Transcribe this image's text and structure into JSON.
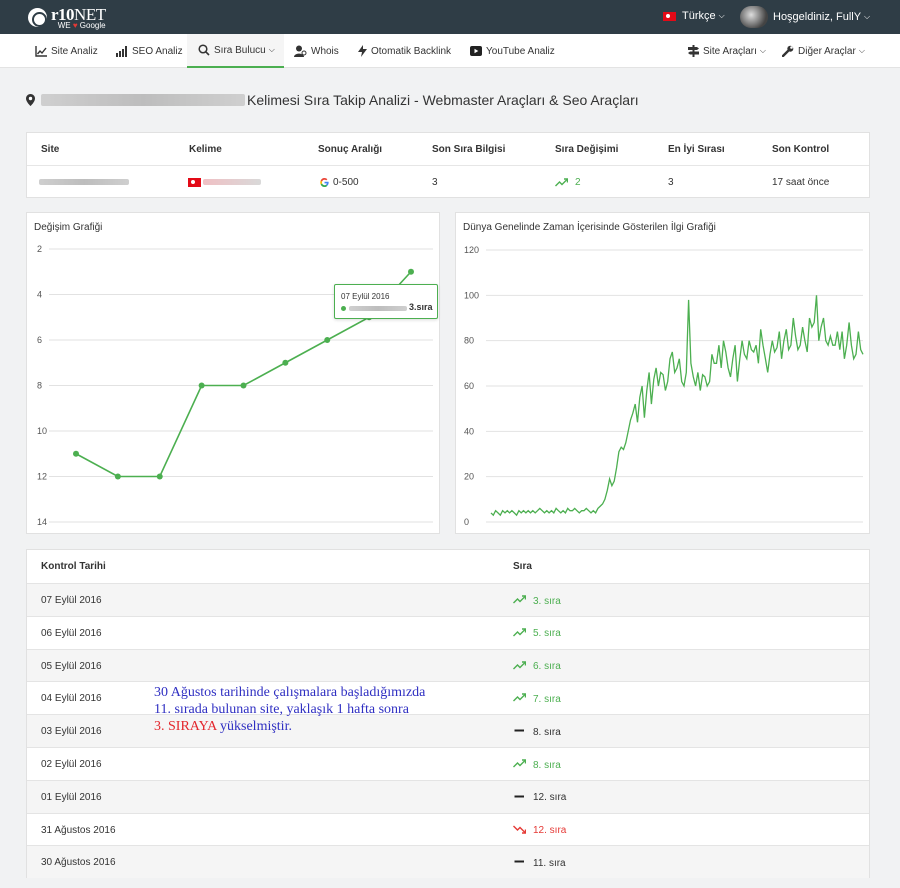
{
  "topbar": {
    "logo_main": "r10",
    "logo_net": "NET",
    "logo_sub_we": "WE",
    "logo_sub_google": "Google",
    "language": "Türkçe",
    "user_greeting": "Hoşgeldiniz, FullY"
  },
  "nav": {
    "items": [
      {
        "label": "Site Analiz",
        "icon": "chart-line-icon"
      },
      {
        "label": "SEO Analiz",
        "icon": "bar-chart-icon"
      },
      {
        "label": "Sıra Bulucu",
        "icon": "search-icon",
        "active": true
      },
      {
        "label": "Whois",
        "icon": "user-search-icon"
      },
      {
        "label": "Otomatik Backlink",
        "icon": "bolt-icon"
      },
      {
        "label": "YouTube Analiz",
        "icon": "youtube-icon"
      }
    ],
    "right_items": [
      {
        "label": "Site Araçları",
        "icon": "signpost-icon"
      },
      {
        "label": "Diğer Araçlar",
        "icon": "wrench-icon"
      }
    ]
  },
  "page": {
    "title": "Kelimesi Sıra Takip Analizi - Webmaster Araçları & Seo Araçları"
  },
  "info_table": {
    "headers": [
      "Site",
      "Kelime",
      "Sonuç Aralığı",
      "Son Sıra Bilgisi",
      "Sıra Değişimi",
      "En İyi Sırası",
      "Son Kontrol"
    ],
    "row": {
      "result_range": "0-500",
      "last_rank": "3",
      "rank_change": "2",
      "best_rank": "3",
      "last_check": "17 saat önce"
    }
  },
  "change_chart": {
    "title": "Değişim Grafiği",
    "tooltip_date": "07 Eylül 2016",
    "tooltip_value": "3.sıra"
  },
  "interest_chart": {
    "title": "Dünya Genelinde Zaman İçerisinde Gösterilen İlgi Grafiği"
  },
  "chart_data": [
    {
      "type": "line",
      "title": "Değişim Grafiği",
      "x": [
        "30 Ağustos 2016",
        "31 Ağustos 2016",
        "01 Eylül 2016",
        "02 Eylül 2016",
        "03 Eylül 2016",
        "04 Eylül 2016",
        "05 Eylül 2016",
        "06 Eylül 2016",
        "07 Eylül 2016"
      ],
      "values": [
        11,
        12,
        12,
        8,
        8,
        7,
        6,
        5,
        3
      ],
      "ylim": [
        2,
        14
      ],
      "y_ticks": [
        2,
        4,
        6,
        8,
        10,
        12,
        14
      ],
      "y_inverted": true,
      "grid": true,
      "color": "#4caf50"
    },
    {
      "type": "line",
      "title": "Dünya Genelinde Zaman İçerisinde Gösterilen İlgi Grafiği",
      "values": [
        4,
        3,
        5,
        4,
        3,
        5,
        4,
        5,
        4,
        5,
        4,
        3,
        5,
        4,
        5,
        4,
        5,
        4,
        5,
        4,
        5,
        6,
        5,
        4,
        5,
        4,
        5,
        4,
        6,
        5,
        4,
        5,
        4,
        6,
        5,
        5,
        6,
        5,
        4,
        5,
        5,
        6,
        5,
        4,
        5,
        4,
        6,
        7,
        8,
        10,
        14,
        19,
        16,
        18,
        24,
        31,
        33,
        32,
        35,
        40,
        45,
        48,
        52,
        44,
        55,
        60,
        46,
        58,
        66,
        52,
        63,
        68,
        60,
        66,
        65,
        58,
        62,
        72,
        75,
        66,
        68,
        72,
        62,
        60,
        66,
        98,
        70,
        64,
        60,
        66,
        58,
        65,
        64,
        60,
        62,
        74,
        70,
        70,
        78,
        68,
        80,
        75,
        68,
        64,
        72,
        78,
        62,
        72,
        80,
        74,
        72,
        80,
        76,
        75,
        78,
        70,
        85,
        78,
        72,
        66,
        74,
        80,
        75,
        77,
        84,
        72,
        80,
        85,
        76,
        78,
        90,
        82,
        76,
        78,
        86,
        80,
        75,
        90,
        86,
        88,
        100,
        80,
        86,
        90,
        80,
        78,
        82,
        78,
        78,
        84,
        76,
        84,
        72,
        78,
        88,
        78,
        72,
        74,
        84,
        76,
        74
      ],
      "ylim": [
        0,
        120
      ],
      "y_ticks": [
        0,
        20,
        40,
        60,
        80,
        100,
        120
      ],
      "grid": true,
      "color": "#4caf50"
    }
  ],
  "history_table": {
    "headers": [
      "Kontrol Tarihi",
      "Sıra"
    ],
    "rows": [
      {
        "date": "07 Eylül 2016",
        "rank": "3. sıra",
        "trend": "up"
      },
      {
        "date": "06 Eylül 2016",
        "rank": "5. sıra",
        "trend": "up"
      },
      {
        "date": "05 Eylül 2016",
        "rank": "6. sıra",
        "trend": "up"
      },
      {
        "date": "04 Eylül 2016",
        "rank": "7. sıra",
        "trend": "up"
      },
      {
        "date": "03 Eylül 2016",
        "rank": "8. sıra",
        "trend": "same"
      },
      {
        "date": "02 Eylül 2016",
        "rank": "8. sıra",
        "trend": "up"
      },
      {
        "date": "01 Eylül 2016",
        "rank": "12. sıra",
        "trend": "same"
      },
      {
        "date": "31 Ağustos 2016",
        "rank": "12. sıra",
        "trend": "down"
      },
      {
        "date": "30 Ağustos 2016",
        "rank": "11. sıra",
        "trend": "same"
      }
    ]
  },
  "annotation": {
    "line1": "30 Ağustos tarihinde çalışmalara başladığımızda",
    "line2": "11. sırada bulunan site, yaklaşık 1 hafta sonra",
    "line3_red": "3. SIRAYA",
    "line3_rest": " yükselmiştir."
  },
  "colors": {
    "topbar_bg": "#2f3d46",
    "accent_green": "#4caf50",
    "down_red": "#e53935",
    "annotation_blue": "#2f2fc2"
  }
}
